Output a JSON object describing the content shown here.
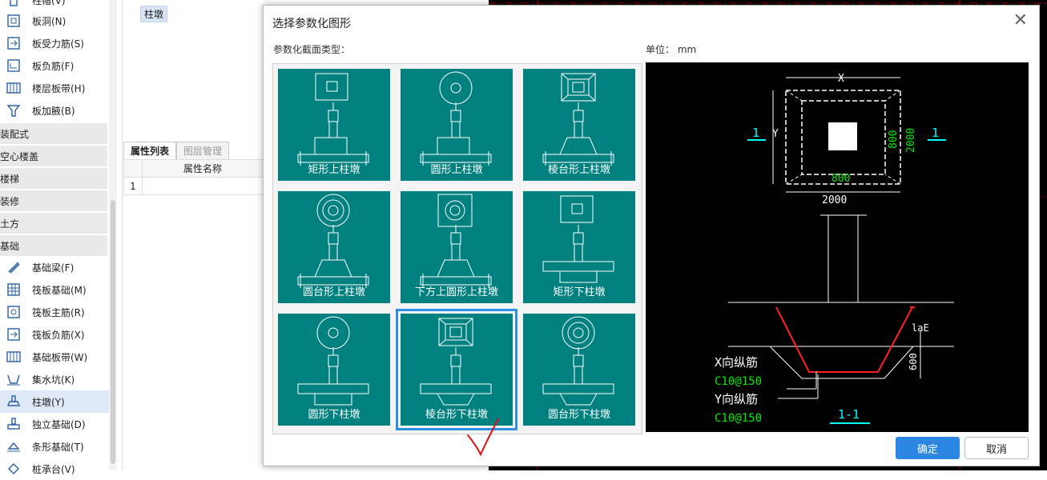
{
  "sidebar": {
    "items_top": [
      {
        "label": "柱帽(V)",
        "icon": "column-cap-icon"
      },
      {
        "label": "板洞(N)",
        "icon": "slab-hole-icon"
      },
      {
        "label": "板受力筋(S)",
        "icon": "slab-rebar-icon"
      },
      {
        "label": "板负筋(F)",
        "icon": "slab-negative-rebar-icon"
      },
      {
        "label": "楼层板带(H)",
        "icon": "floor-strip-icon"
      },
      {
        "label": "板加腋(B)",
        "icon": "slab-haunch-icon"
      }
    ],
    "groups": [
      "装配式",
      "空心楼盖",
      "楼梯",
      "装修",
      "土方",
      "基础"
    ],
    "items_bottom": [
      {
        "label": "基础梁(F)",
        "icon": "foundation-beam-icon"
      },
      {
        "label": "筏板基础(M)",
        "icon": "raft-foundation-icon"
      },
      {
        "label": "筏板主筋(R)",
        "icon": "raft-main-rebar-icon"
      },
      {
        "label": "筏板负筋(X)",
        "icon": "raft-negative-rebar-icon"
      },
      {
        "label": "基础板带(W)",
        "icon": "foundation-strip-icon"
      },
      {
        "label": "集水坑(K)",
        "icon": "sump-pit-icon"
      },
      {
        "label": "柱墩(Y)",
        "icon": "column-pier-icon"
      },
      {
        "label": "独立基础(D)",
        "icon": "isolated-footing-icon"
      },
      {
        "label": "条形基础(T)",
        "icon": "strip-footing-icon"
      },
      {
        "label": "桩承台(V)",
        "icon": "pile-cap-icon"
      }
    ]
  },
  "component_tag": "柱墩",
  "props": {
    "tabs": [
      "属性列表",
      "图层管理"
    ],
    "header": "属性名称",
    "row_number": "1"
  },
  "dialog": {
    "title": "选择参数化图形",
    "close_symbol": "✕",
    "section_label": "参数化截面类型：",
    "unit_label": "单位：  mm",
    "shapes": [
      {
        "caption": "矩形上柱墩",
        "top": "rect",
        "bottom": "up",
        "tr": "rect"
      },
      {
        "caption": "圆形上柱墩",
        "top": "circle",
        "bottom": "up",
        "tr": "rect"
      },
      {
        "caption": "棱台形上柱墩",
        "top": "frustum",
        "bottom": "up",
        "tr": "trap"
      },
      {
        "caption": "圆台形上柱墩",
        "top": "cone",
        "bottom": "up",
        "tr": "trap"
      },
      {
        "caption": "下方上圆形上柱墩",
        "top": "sqcircle",
        "bottom": "up",
        "tr": "trap"
      },
      {
        "caption": "矩形下柱墩",
        "top": "rect",
        "bottom": "down",
        "tr": "rect"
      },
      {
        "caption": "圆形下柱墩",
        "top": "circle",
        "bottom": "down",
        "tr": "rect"
      },
      {
        "caption": "棱台形下柱墩",
        "top": "frustum",
        "bottom": "down",
        "tr": "trap"
      },
      {
        "caption": "圆台形下柱墩",
        "top": "cone",
        "bottom": "down",
        "tr": "trap"
      }
    ],
    "selected_index": 7,
    "preview": {
      "dim_x": "X",
      "dim_y": "Y",
      "dim_800_h": "800",
      "dim_2000_h": "2000",
      "dim_800_v": "800",
      "dim_2000_v": "2000",
      "section_mark": "1",
      "lae": "laE",
      "dim_600": "600",
      "x_rebar": "X向纵筋",
      "x_rebar_spec": "C10@150",
      "y_rebar": "Y向纵筋",
      "y_rebar_spec": "C10@150",
      "section_title": "1-1",
      "colors": {
        "white": "#ffffff",
        "green": "#00e000",
        "cyan": "#00ffff",
        "red": "#ff2020",
        "yellow": "#ffff00"
      }
    },
    "ok_label": "确定",
    "cancel_label": "取消"
  }
}
